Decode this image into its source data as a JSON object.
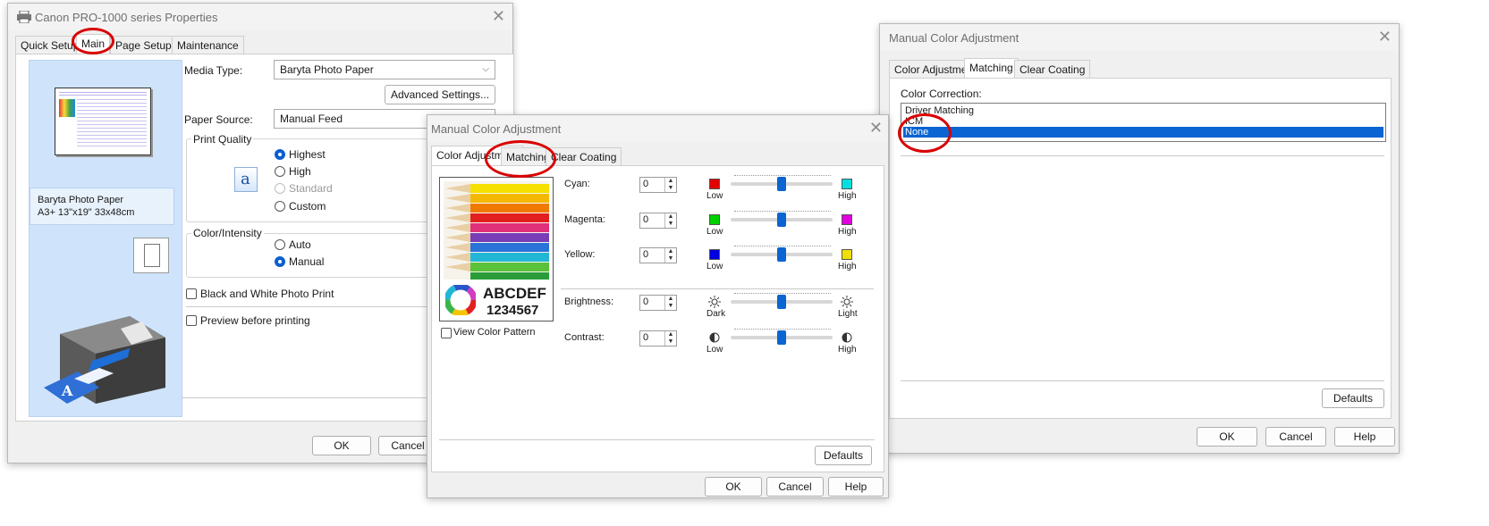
{
  "win1": {
    "title": "Canon PRO-1000 series Properties",
    "tabs": [
      "Quick Setup",
      "Main",
      "Page Setup",
      "Maintenance"
    ],
    "active_tab": "Main",
    "preview_paper": "Baryta Photo Paper",
    "preview_size": "A3+ 13\"x19\" 33x48cm",
    "media_type_label": "Media Type:",
    "media_type_value": "Baryta Photo Paper",
    "advanced_button": "Advanced Settings...",
    "paper_source_label": "Paper Source:",
    "paper_source_value": "Manual Feed",
    "print_quality_group": "Print Quality",
    "quality_options": [
      "Highest",
      "High",
      "Standard",
      "Custom"
    ],
    "quality_selected": "Highest",
    "color_group": "Color/Intensity",
    "color_options": [
      "Auto",
      "Manual"
    ],
    "color_selected": "Manual",
    "bw_check": "Black and White Photo Print",
    "preview_check": "Preview before printing",
    "ok": "OK",
    "cancel": "Cancel",
    "quality_glyph": "a",
    "printer_glyph": "A"
  },
  "win2": {
    "title": "Manual Color Adjustment",
    "tabs": [
      "Color Adjustment",
      "Matching",
      "Clear Coating"
    ],
    "active_tab": "Color Adjustment",
    "sample_text1": "ABCDEF",
    "sample_text2": "1234567",
    "view_pattern": "View Color Pattern",
    "sliders": [
      {
        "label": "Cyan:",
        "value": "0",
        "low": "Low",
        "high": "High",
        "low_color": "#e00000",
        "high_color": "#00e0e0"
      },
      {
        "label": "Magenta:",
        "value": "0",
        "low": "Low",
        "high": "High",
        "low_color": "#00d000",
        "high_color": "#e000e0"
      },
      {
        "label": "Yellow:",
        "value": "0",
        "low": "Low",
        "high": "High",
        "low_color": "#0000e0",
        "high_color": "#f0e000"
      },
      {
        "label": "Brightness:",
        "value": "0",
        "low": "Dark",
        "high": "Light"
      },
      {
        "label": "Contrast:",
        "value": "0",
        "low": "Low",
        "high": "High"
      }
    ],
    "defaults": "Defaults",
    "ok": "OK",
    "cancel": "Cancel",
    "help": "Help"
  },
  "win3": {
    "title": "Manual Color Adjustment",
    "tabs": [
      "Color Adjustment",
      "Matching",
      "Clear Coating"
    ],
    "active_tab": "Matching",
    "color_correction_label": "Color Correction:",
    "options": [
      "Driver Matching",
      "ICM",
      "None"
    ],
    "selected": "None",
    "defaults": "Defaults",
    "ok": "OK",
    "cancel": "Cancel",
    "help": "Help"
  },
  "colors": {
    "accent": "#0a64d2",
    "highlight_ring": "#d90000",
    "preview_panel": "#cfe4fb"
  }
}
